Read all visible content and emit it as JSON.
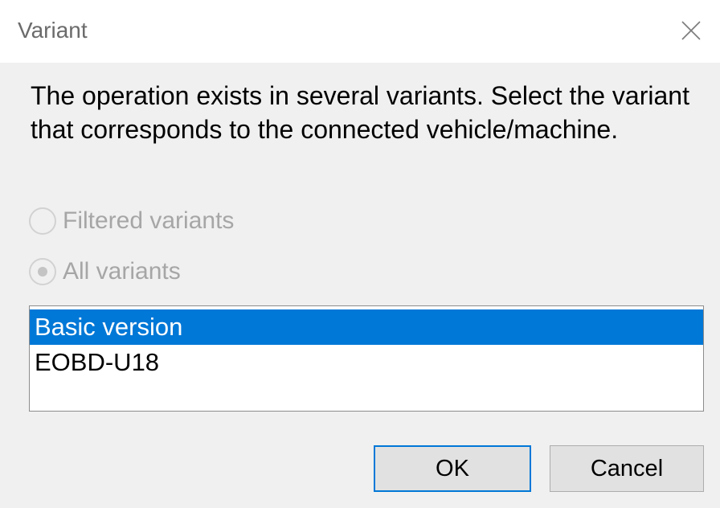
{
  "window": {
    "title": "Variant",
    "close_icon": "close-x-icon"
  },
  "message": "The operation exists in several variants. Select the variant that corresponds to the connected vehicle/machine.",
  "options": {
    "filtered": {
      "label": "Filtered variants",
      "selected": false,
      "enabled": false
    },
    "all": {
      "label": "All variants",
      "selected": true,
      "enabled": false
    }
  },
  "variants": {
    "items": [
      "Basic version",
      "EOBD-U18"
    ],
    "selected": "Basic version"
  },
  "buttons": {
    "ok": "OK",
    "cancel": "Cancel"
  },
  "colors": {
    "selection": "#0078d7",
    "disabled_text": "#a6a6a6",
    "dialog_background": "#f0f0f0"
  }
}
